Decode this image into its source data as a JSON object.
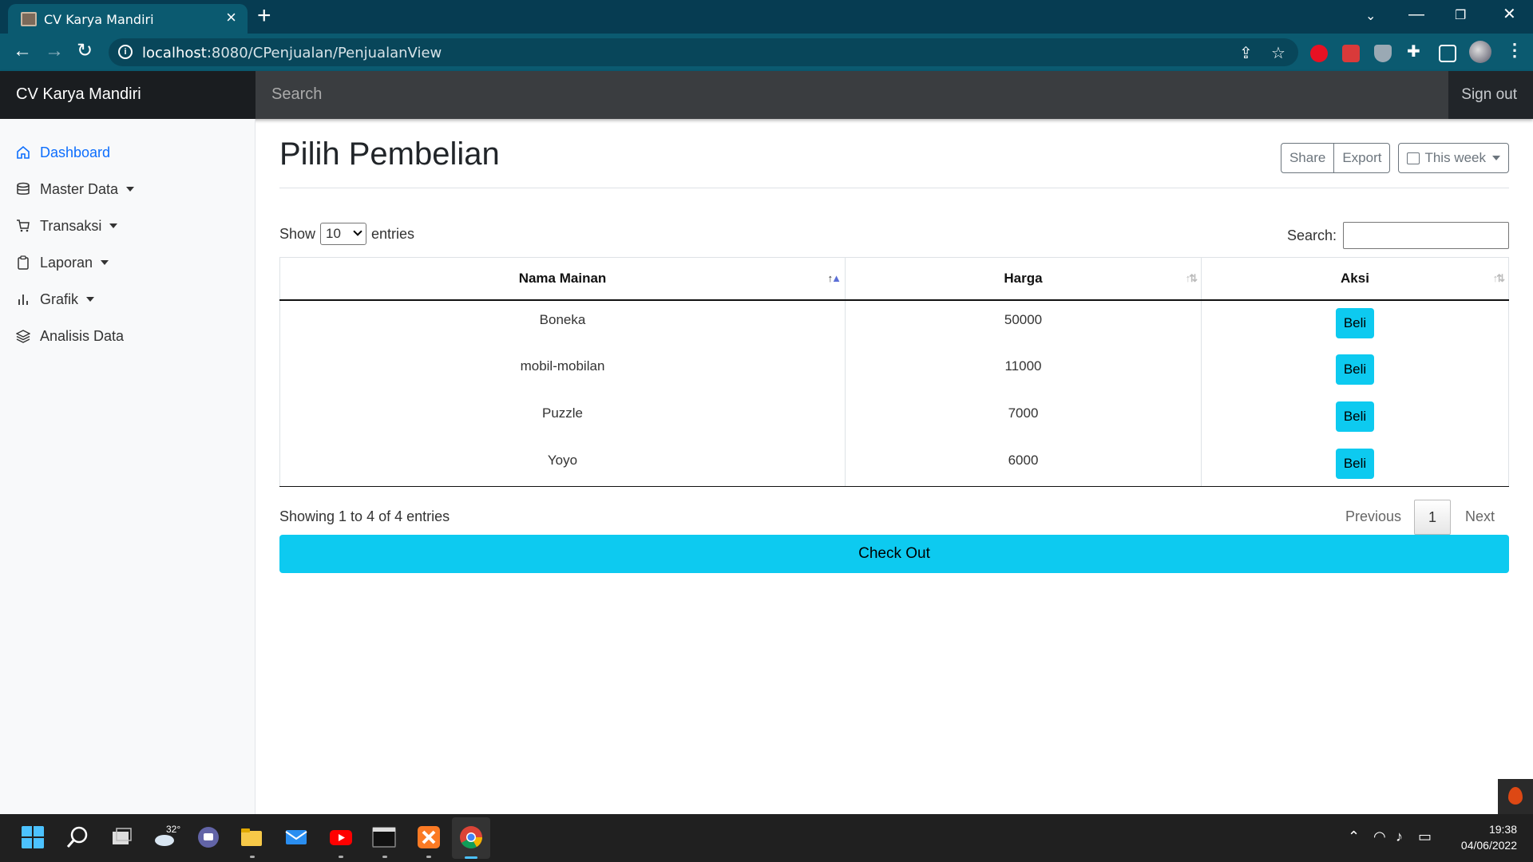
{
  "browser": {
    "tab_title": "CV Karya Mandiri",
    "url_host": "localhost",
    "url_rest": ":8080/CPenjualan/PenjualanView"
  },
  "navbar": {
    "brand": "CV Karya Mandiri",
    "search_placeholder": "Search",
    "signout": "Sign out"
  },
  "sidebar": {
    "items": [
      {
        "label": "Dashboard",
        "icon": "home-icon"
      },
      {
        "label": "Master Data",
        "icon": "database-icon"
      },
      {
        "label": "Transaksi",
        "icon": "cart-icon"
      },
      {
        "label": "Laporan",
        "icon": "clipboard-icon"
      },
      {
        "label": "Grafik",
        "icon": "bar-chart-icon"
      },
      {
        "label": "Analisis Data",
        "icon": "layers-icon"
      }
    ]
  },
  "main": {
    "title": "Pilih Pembelian",
    "share": "Share",
    "export": "Export",
    "period": "This week",
    "show_label": "Show",
    "entries_value": "10",
    "entries_label": "entries",
    "search_label": "Search:",
    "columns": [
      "Nama Mainan",
      "Harga",
      "Aksi"
    ],
    "rows": [
      {
        "nama": "Boneka",
        "harga": "50000",
        "aksi": "Beli"
      },
      {
        "nama": "mobil-mobilan",
        "harga": "11000",
        "aksi": "Beli"
      },
      {
        "nama": "Puzzle",
        "harga": "7000",
        "aksi": "Beli"
      },
      {
        "nama": "Yoyo",
        "harga": "6000",
        "aksi": "Beli"
      }
    ],
    "info": "Showing 1 to 4 of 4 entries",
    "prev": "Previous",
    "page": "1",
    "next": "Next",
    "checkout": "Check Out"
  },
  "taskbar": {
    "weather": "32°",
    "time": "19:38",
    "date": "04/06/2022"
  },
  "colors": {
    "accent": "#0dcaf0",
    "link": "#0d6efd",
    "navbar": "#212529"
  }
}
